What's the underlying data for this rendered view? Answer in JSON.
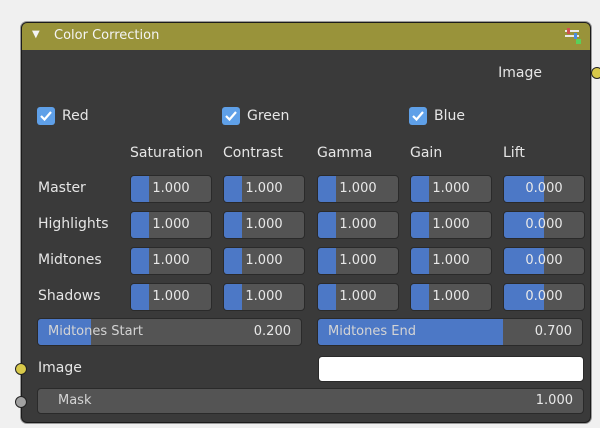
{
  "node": {
    "title": "Color Correction",
    "output_image_label": "Image",
    "channels": [
      {
        "label": "Red",
        "checked": true
      },
      {
        "label": "Green",
        "checked": true
      },
      {
        "label": "Blue",
        "checked": true
      }
    ],
    "columns": [
      "Saturation",
      "Contrast",
      "Gamma",
      "Gain",
      "Lift"
    ],
    "rows": [
      {
        "label": "Master",
        "values": [
          "1.000",
          "1.000",
          "1.000",
          "1.000",
          "0.000"
        ],
        "fills": [
          0.23,
          0.23,
          0.23,
          0.23,
          0.5
        ]
      },
      {
        "label": "Highlights",
        "values": [
          "1.000",
          "1.000",
          "1.000",
          "1.000",
          "0.000"
        ],
        "fills": [
          0.23,
          0.23,
          0.23,
          0.23,
          0.5
        ]
      },
      {
        "label": "Midtones",
        "values": [
          "1.000",
          "1.000",
          "1.000",
          "1.000",
          "0.000"
        ],
        "fills": [
          0.23,
          0.23,
          0.23,
          0.23,
          0.5
        ]
      },
      {
        "label": "Shadows",
        "values": [
          "1.000",
          "1.000",
          "1.000",
          "1.000",
          "0.000"
        ],
        "fills": [
          0.23,
          0.23,
          0.23,
          0.23,
          0.5
        ]
      }
    ],
    "midtones_start": {
      "label": "Midtones Start",
      "value": "0.200",
      "fill": 0.2
    },
    "midtones_end": {
      "label": "Midtones End",
      "value": "0.700",
      "fill": 0.7
    },
    "input_image_label": "Image",
    "mask": {
      "label": "Mask",
      "value": "1.000"
    },
    "colors": {
      "header": "#99933a",
      "accent": "#4c78c6",
      "checkbox": "#5fa0e8",
      "socket_image": "#d8c94a",
      "socket_mask": "#a0a0a0"
    }
  }
}
